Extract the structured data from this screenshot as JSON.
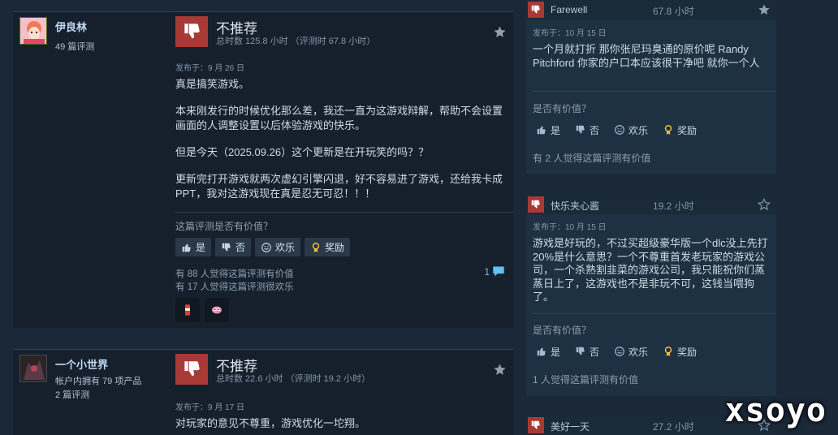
{
  "reviews": [
    {
      "author": {
        "name": "伊良林",
        "line1": "49 篇评测",
        "line2": ""
      },
      "vote": "不推荐",
      "playtime": "总时数 125.8 小时 （评测时 67.8 小时）",
      "posted": "发布于：9 月 26 日",
      "paragraphs": [
        "真是搞笑游戏。",
        "本来刚发行的时候优化那么差，我还一直为这游戏辩解，帮助不会设置画面的人调整设置以后体验游戏的快乐。",
        "但是今天（2025.09.26）这个更新是在开玩笑的吗？？",
        "更新完打开游戏就两次虚幻引擎闪退，好不容易进了游戏，还给我卡成PPT，我对这游戏现在真是忍无可忍！！！"
      ],
      "helpful_question": "这篇评测是否有价值？",
      "buttons": {
        "yes": "是",
        "no": "否",
        "funny": "欢乐",
        "award": "奖励"
      },
      "helpful_count": "有 88 人觉得这篇评测有价值",
      "funny_count": "有 17 人觉得这篇评测很欢乐",
      "comments": "1"
    },
    {
      "author": {
        "name": "一个小世界",
        "line1": "帐户内拥有 79 项产品",
        "line2": "2 篇评测"
      },
      "vote": "不推荐",
      "playtime": "总时数 22.6 小时 （评测时 19.2 小时）",
      "posted": "发布于：9 月 17 日",
      "paragraphs": [
        "对玩家的意见不尊重，游戏优化一坨翔。"
      ]
    }
  ],
  "side_cards": [
    {
      "author": "Farewell",
      "hours": "67.8 小时",
      "posted": "发布于：10 月 15 日",
      "text": "一个月就打折 那你张尼玛臭通的原价呢 Randy Pitchford 你家的户口本应该很干净吧 就你一个人",
      "question": "是否有价值？",
      "buttons": {
        "yes": "是",
        "no": "否",
        "funny": "欢乐",
        "award": "奖励"
      },
      "count": "有 2 人觉得这篇评测有价值"
    },
    {
      "author": "快乐夹心酱",
      "hours": "19.2 小时",
      "posted": "发布于：10 月 15 日",
      "text": "游戏是好玩的，不过买超级豪华版一个dlc没上先打20%是什么意思？一个不尊重首发老玩家的游戏公司，一个杀熟割韭菜的游戏公司，我只能祝你们蒸蒸日上了，这游戏也不是非玩不可，这钱当喂狗了。",
      "question": "是否有价值？",
      "buttons": {
        "yes": "是",
        "no": "否",
        "funny": "欢乐",
        "award": "奖励"
      },
      "count": "1 人觉得这篇评测有价值"
    },
    {
      "author": "美好一天",
      "hours": "27.2 小时"
    }
  ],
  "watermark": "xsoyo",
  "colors": {
    "background": "#1b2838",
    "thumb_down": "#a83a35",
    "link": "#66c0f4"
  }
}
